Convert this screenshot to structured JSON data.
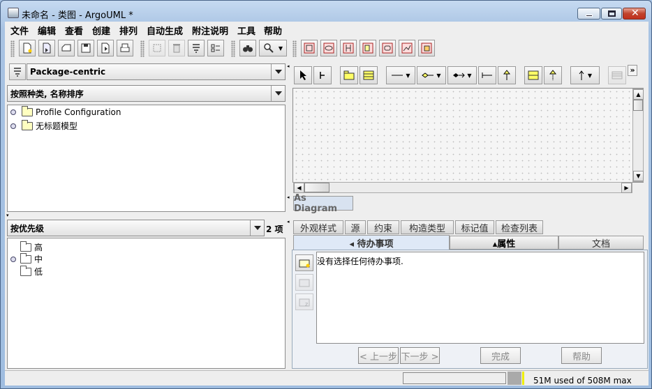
{
  "window": {
    "title": "未命名 - 类图 - ArgoUML *"
  },
  "menubar": [
    "文件",
    "编辑",
    "查看",
    "创建",
    "排列",
    "自动生成",
    "附注说明",
    "工具",
    "帮助"
  ],
  "explorer": {
    "perspective": "Package-centric",
    "ordering": "按照种类, 名称排序",
    "tree": [
      "Profile Configuration",
      "无标题模型"
    ]
  },
  "todo": {
    "ordering": "按优先级",
    "count": "2 项",
    "tree": [
      "高",
      "中",
      "低"
    ]
  },
  "diagram": {
    "tab_label": "As Diagram"
  },
  "details": {
    "tabs_top": [
      "外观样式",
      "源",
      "约束",
      "构造类型",
      "标记值",
      "检查列表"
    ],
    "tabs_bottom": [
      "◂ 待办事项",
      "▴属性",
      "文档"
    ],
    "message": "没有选择任何待办事项.",
    "buttons": {
      "prev": "< 上一步",
      "next": "下一步 >",
      "finish": "完成",
      "help": "帮助"
    }
  },
  "status": {
    "memory": "51M used of 508M max"
  }
}
